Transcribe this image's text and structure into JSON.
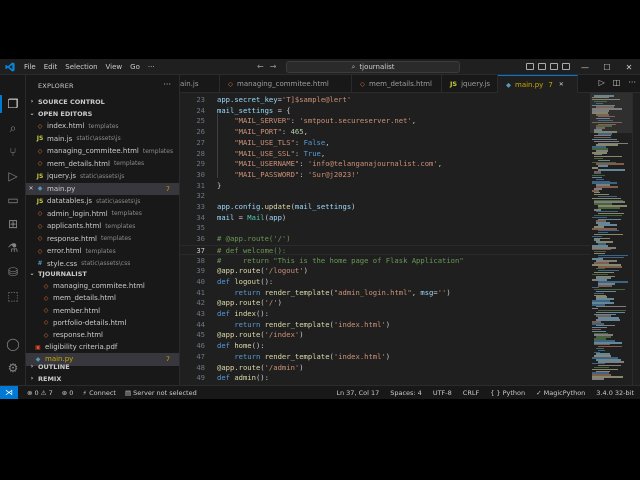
{
  "app": {
    "search_text": "tjournalist",
    "menu": [
      "File",
      "Edit",
      "Selection",
      "View",
      "Go",
      "···"
    ]
  },
  "sidebar": {
    "title": "EXPLORER",
    "more": "···",
    "sections": {
      "source_control": "SOURCE CONTROL",
      "open_editors": "OPEN EDITORS",
      "workspace": "TJOURNALIST",
      "outline": "OUTLINE",
      "remix": "REMIX"
    },
    "open_editors": [
      {
        "name": "index.html",
        "desc": "templates",
        "type": "html"
      },
      {
        "name": "main.js",
        "desc": "static\\assets\\js",
        "type": "js"
      },
      {
        "name": "managing_commitee.html",
        "desc": "templates",
        "type": "html"
      },
      {
        "name": "mem_details.html",
        "desc": "templates",
        "type": "html"
      },
      {
        "name": "jquery.js",
        "desc": "static\\assets\\js",
        "type": "js"
      },
      {
        "name": "main.py",
        "desc": "",
        "type": "py",
        "badge": "7",
        "selected": true
      },
      {
        "name": "datatables.js",
        "desc": "static\\assets\\js",
        "type": "js"
      },
      {
        "name": "admin_login.html",
        "desc": "templates",
        "type": "html"
      },
      {
        "name": "applicants.html",
        "desc": "templates",
        "type": "html"
      },
      {
        "name": "response.html",
        "desc": "templates",
        "type": "html"
      },
      {
        "name": "error.html",
        "desc": "templates",
        "type": "html"
      },
      {
        "name": "style.css",
        "desc": "static\\assets\\css",
        "type": "css"
      }
    ],
    "workspace_files": [
      {
        "name": "managing_commitee.html",
        "type": "html",
        "indent": 2
      },
      {
        "name": "mem_details.html",
        "type": "html",
        "indent": 2
      },
      {
        "name": "member.html",
        "type": "html",
        "indent": 2
      },
      {
        "name": "portfolio-details.html",
        "type": "html",
        "indent": 2
      },
      {
        "name": "response.html",
        "type": "html",
        "indent": 2
      },
      {
        "name": "eligibility criteria.pdf",
        "type": "pdf",
        "indent": 1
      },
      {
        "name": "main.py",
        "type": "py",
        "indent": 1,
        "badge": "7",
        "selected": true
      }
    ]
  },
  "tabs": [
    {
      "name": "ain.js",
      "type": "js"
    },
    {
      "name": "managing_commitee.html",
      "type": "html"
    },
    {
      "name": "mem_details.html",
      "type": "html"
    },
    {
      "name": "jquery.js",
      "type": "js"
    },
    {
      "name": "main.py",
      "type": "py",
      "badge": "7",
      "active": true
    }
  ],
  "editor": {
    "current_line": 37,
    "lines": [
      {
        "n": 23,
        "tokens": [
          [
            "var",
            "app"
          ],
          [
            "",
            "."
          ],
          [
            "var",
            "secret_key"
          ],
          [
            "",
            "="
          ],
          [
            "str",
            "'T]$sample@lert'"
          ]
        ]
      },
      {
        "n": 24,
        "tokens": [
          [
            "var",
            "mail_settings"
          ],
          [
            "",
            " = {"
          ]
        ]
      },
      {
        "n": 25,
        "tokens": [
          [
            "",
            "    "
          ],
          [
            "str",
            "\"MAIL_SERVER\""
          ],
          [
            "",
            ": "
          ],
          [
            "str",
            "'smtpout.secureserver.net'"
          ],
          [
            "",
            ","
          ]
        ]
      },
      {
        "n": 26,
        "tokens": [
          [
            "",
            "    "
          ],
          [
            "str",
            "\"MAIL_PORT\""
          ],
          [
            "",
            ": "
          ],
          [
            "num",
            "465"
          ],
          [
            "",
            ","
          ]
        ]
      },
      {
        "n": 27,
        "tokens": [
          [
            "",
            "    "
          ],
          [
            "str",
            "\"MAIL_USE_TLS\""
          ],
          [
            "",
            ": "
          ],
          [
            "kw",
            "False"
          ],
          [
            "",
            ","
          ]
        ]
      },
      {
        "n": 28,
        "tokens": [
          [
            "",
            "    "
          ],
          [
            "str",
            "\"MAIL_USE_SSL\""
          ],
          [
            "",
            ": "
          ],
          [
            "kw",
            "True"
          ],
          [
            "",
            ","
          ]
        ]
      },
      {
        "n": 29,
        "tokens": [
          [
            "",
            "    "
          ],
          [
            "str",
            "\"MAIL_USERNAME\""
          ],
          [
            "",
            ": "
          ],
          [
            "str",
            "'info@telanganajournalist.com'"
          ],
          [
            "",
            ","
          ]
        ]
      },
      {
        "n": 30,
        "tokens": [
          [
            "",
            "    "
          ],
          [
            "str",
            "\"MAIL_PASSWORD\""
          ],
          [
            "",
            ": "
          ],
          [
            "str",
            "'Sur@j2023!'"
          ]
        ]
      },
      {
        "n": 31,
        "tokens": [
          [
            "",
            "}"
          ]
        ]
      },
      {
        "n": 32,
        "tokens": []
      },
      {
        "n": 33,
        "tokens": [
          [
            "var",
            "app"
          ],
          [
            "",
            "."
          ],
          [
            "var",
            "config"
          ],
          [
            "",
            "."
          ],
          [
            "fn",
            "update"
          ],
          [
            "",
            "("
          ],
          [
            "var",
            "mail_settings"
          ],
          [
            "",
            ")"
          ]
        ]
      },
      {
        "n": 34,
        "tokens": [
          [
            "var",
            "mail"
          ],
          [
            "",
            " = "
          ],
          [
            "cls",
            "Mail"
          ],
          [
            "",
            "("
          ],
          [
            "var",
            "app"
          ],
          [
            "",
            ")"
          ]
        ]
      },
      {
        "n": 35,
        "tokens": []
      },
      {
        "n": 36,
        "tokens": [
          [
            "cmt",
            "# @app.route('/')"
          ]
        ]
      },
      {
        "n": 37,
        "tokens": [
          [
            "cmt",
            "# def welcome():"
          ]
        ]
      },
      {
        "n": 38,
        "tokens": [
          [
            "cmt",
            "#     return \"This is the home page of Flask Application\""
          ]
        ]
      },
      {
        "n": 39,
        "tokens": [
          [
            "dec",
            "@app.route"
          ],
          [
            "",
            "("
          ],
          [
            "str",
            "'/logout'"
          ],
          [
            "",
            ")"
          ]
        ]
      },
      {
        "n": 40,
        "tokens": [
          [
            "kw",
            "def"
          ],
          [
            "",
            " "
          ],
          [
            "fn",
            "logout"
          ],
          [
            "",
            "():"
          ]
        ]
      },
      {
        "n": 41,
        "tokens": [
          [
            "",
            "    "
          ],
          [
            "kw",
            "return"
          ],
          [
            "",
            " "
          ],
          [
            "fn",
            "render_template"
          ],
          [
            "",
            "("
          ],
          [
            "str",
            "\"admin_login.html\""
          ],
          [
            "",
            ", "
          ],
          [
            "var",
            "msg"
          ],
          [
            "",
            "="
          ],
          [
            "str",
            "''"
          ],
          [
            "",
            ")"
          ]
        ]
      },
      {
        "n": 42,
        "tokens": [
          [
            "dec",
            "@app.route"
          ],
          [
            "",
            "("
          ],
          [
            "str",
            "'/'"
          ],
          [
            "",
            ")"
          ]
        ]
      },
      {
        "n": 43,
        "tokens": [
          [
            "kw",
            "def"
          ],
          [
            "",
            " "
          ],
          [
            "fn",
            "index"
          ],
          [
            "",
            "():"
          ]
        ]
      },
      {
        "n": 44,
        "tokens": [
          [
            "",
            "    "
          ],
          [
            "kw",
            "return"
          ],
          [
            "",
            " "
          ],
          [
            "fn",
            "render_template"
          ],
          [
            "",
            "("
          ],
          [
            "str",
            "'index.html'"
          ],
          [
            "",
            ")"
          ]
        ]
      },
      {
        "n": 45,
        "tokens": [
          [
            "dec",
            "@app.route"
          ],
          [
            "",
            "("
          ],
          [
            "str",
            "'/index'"
          ],
          [
            "",
            ")"
          ]
        ]
      },
      {
        "n": 46,
        "tokens": [
          [
            "kw",
            "def"
          ],
          [
            "",
            " "
          ],
          [
            "fn",
            "home"
          ],
          [
            "",
            "():"
          ]
        ]
      },
      {
        "n": 47,
        "tokens": [
          [
            "",
            "    "
          ],
          [
            "kw",
            "return"
          ],
          [
            "",
            " "
          ],
          [
            "fn",
            "render_template"
          ],
          [
            "",
            "("
          ],
          [
            "str",
            "'index.html'"
          ],
          [
            "",
            ")"
          ]
        ]
      },
      {
        "n": 48,
        "tokens": [
          [
            "dec",
            "@app.route"
          ],
          [
            "",
            "("
          ],
          [
            "str",
            "'/admin'"
          ],
          [
            "",
            ")"
          ]
        ]
      },
      {
        "n": 49,
        "tokens": [
          [
            "kw",
            "def"
          ],
          [
            "",
            " "
          ],
          [
            "fn",
            "admin"
          ],
          [
            "",
            "():"
          ]
        ]
      }
    ]
  },
  "status": {
    "errors": "0",
    "warnings": "7",
    "ports": "0",
    "connect": "Connect",
    "server": "Server not selected",
    "position": "Ln 37, Col 17",
    "spaces": "Spaces: 4",
    "encoding": "UTF-8",
    "eol": "CRLF",
    "language": "Python",
    "extension": "MagicPython",
    "interpreter": "3.4.0 32-bit"
  },
  "colors": {
    "accent": "#0078d4",
    "modified": "#cca700",
    "background": "#1f1f1f",
    "sidebar": "#181818"
  }
}
